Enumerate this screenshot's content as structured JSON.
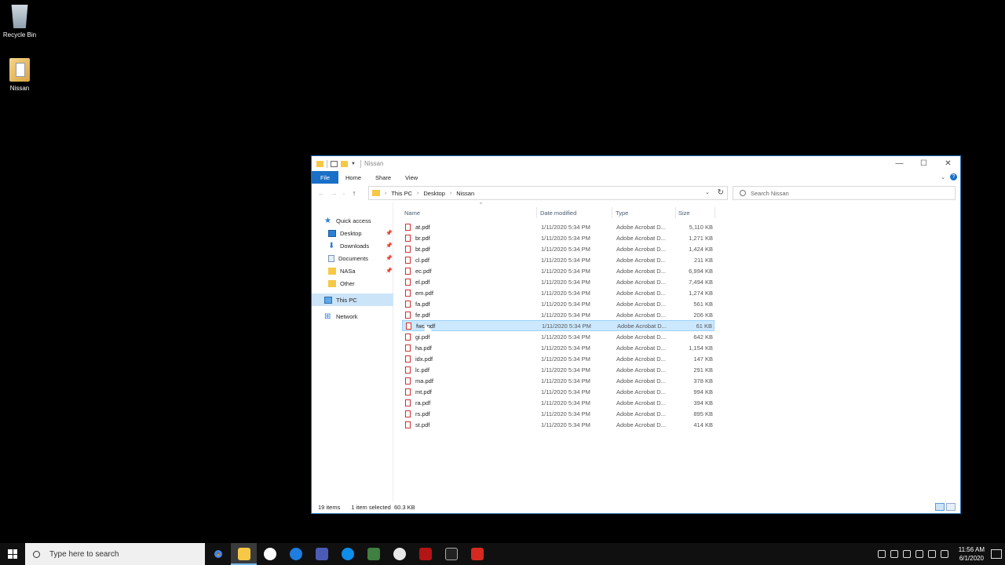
{
  "desktop": {
    "icons": [
      {
        "label": "Recycle Bin"
      },
      {
        "label": "Nissan"
      }
    ]
  },
  "window": {
    "title": "Nissan",
    "ribbon_tabs": [
      "File",
      "Home",
      "Share",
      "View"
    ],
    "breadcrumb": [
      "This PC",
      "Desktop",
      "Nissan"
    ],
    "search_placeholder": "Search Nissan",
    "nav": [
      {
        "label": "Quick access",
        "icon": "star-icon"
      },
      {
        "label": "Desktop",
        "icon": "desktop-icon",
        "pinned": true
      },
      {
        "label": "Downloads",
        "icon": "download-arrow-icon",
        "pinned": true
      },
      {
        "label": "Documents",
        "icon": "documents-icon",
        "pinned": true
      },
      {
        "label": "NASa",
        "icon": "folder-icon",
        "pinned": true
      },
      {
        "label": "Other",
        "icon": "folder-icon"
      },
      {
        "label": "This PC",
        "icon": "computer-icon",
        "selected": true
      },
      {
        "label": "Network",
        "icon": "network-icon"
      }
    ],
    "columns": [
      "Name",
      "Date modified",
      "Type",
      "Size"
    ],
    "files": [
      {
        "name": "at.pdf",
        "date": "1/11/2020 5:34 PM",
        "type": "Adobe Acrobat D...",
        "size": "5,110 KB"
      },
      {
        "name": "br.pdf",
        "date": "1/11/2020 5:34 PM",
        "type": "Adobe Acrobat D...",
        "size": "1,271 KB"
      },
      {
        "name": "bt.pdf",
        "date": "1/11/2020 5:34 PM",
        "type": "Adobe Acrobat D...",
        "size": "1,424 KB"
      },
      {
        "name": "cl.pdf",
        "date": "1/11/2020 5:34 PM",
        "type": "Adobe Acrobat D...",
        "size": "211 KB"
      },
      {
        "name": "ec.pdf",
        "date": "1/11/2020 5:34 PM",
        "type": "Adobe Acrobat D...",
        "size": "6,994 KB"
      },
      {
        "name": "el.pdf",
        "date": "1/11/2020 5:34 PM",
        "type": "Adobe Acrobat D...",
        "size": "7,494 KB"
      },
      {
        "name": "em.pdf",
        "date": "1/11/2020 5:34 PM",
        "type": "Adobe Acrobat D...",
        "size": "1,274 KB"
      },
      {
        "name": "fa.pdf",
        "date": "1/11/2020 5:34 PM",
        "type": "Adobe Acrobat D...",
        "size": "561 KB"
      },
      {
        "name": "fe.pdf",
        "date": "1/11/2020 5:34 PM",
        "type": "Adobe Acrobat D...",
        "size": "206 KB"
      },
      {
        "name": "fwd.pdf",
        "date": "1/11/2020 5:34 PM",
        "type": "Adobe Acrobat D...",
        "size": "61 KB",
        "selected": true
      },
      {
        "name": "gi.pdf",
        "date": "1/11/2020 5:34 PM",
        "type": "Adobe Acrobat D...",
        "size": "642 KB"
      },
      {
        "name": "ha.pdf",
        "date": "1/11/2020 5:34 PM",
        "type": "Adobe Acrobat D...",
        "size": "1,154 KB"
      },
      {
        "name": "idx.pdf",
        "date": "1/11/2020 5:34 PM",
        "type": "Adobe Acrobat D...",
        "size": "147 KB"
      },
      {
        "name": "lc.pdf",
        "date": "1/11/2020 5:34 PM",
        "type": "Adobe Acrobat D...",
        "size": "291 KB"
      },
      {
        "name": "ma.pdf",
        "date": "1/11/2020 5:34 PM",
        "type": "Adobe Acrobat D...",
        "size": "378 KB"
      },
      {
        "name": "mt.pdf",
        "date": "1/11/2020 5:34 PM",
        "type": "Adobe Acrobat D...",
        "size": "994 KB"
      },
      {
        "name": "ra.pdf",
        "date": "1/11/2020 5:34 PM",
        "type": "Adobe Acrobat D...",
        "size": "394 KB"
      },
      {
        "name": "rs.pdf",
        "date": "1/11/2020 5:34 PM",
        "type": "Adobe Acrobat D...",
        "size": "895 KB"
      },
      {
        "name": "st.pdf",
        "date": "1/11/2020 5:34 PM",
        "type": "Adobe Acrobat D...",
        "size": "414 KB"
      }
    ],
    "status": {
      "items": "19 items",
      "selection": "1 item selected  60.3 KB"
    }
  },
  "taskbar": {
    "search_placeholder": "Type here to search",
    "apps": [
      "chrome-icon",
      "file-explorer-icon",
      "slack-icon",
      "app-blue-icon",
      "visual-studio-icon",
      "teamviewer-icon",
      "app-green-icon",
      "steam-icon",
      "filezilla-icon",
      "terminal-icon",
      "acrobat-icon"
    ],
    "time": "11:56 AM",
    "date": "6/1/2020"
  },
  "colors": {
    "accent": "#1a6fc6",
    "selection_bg": "#cce8ff",
    "taskbar": "#101010"
  }
}
